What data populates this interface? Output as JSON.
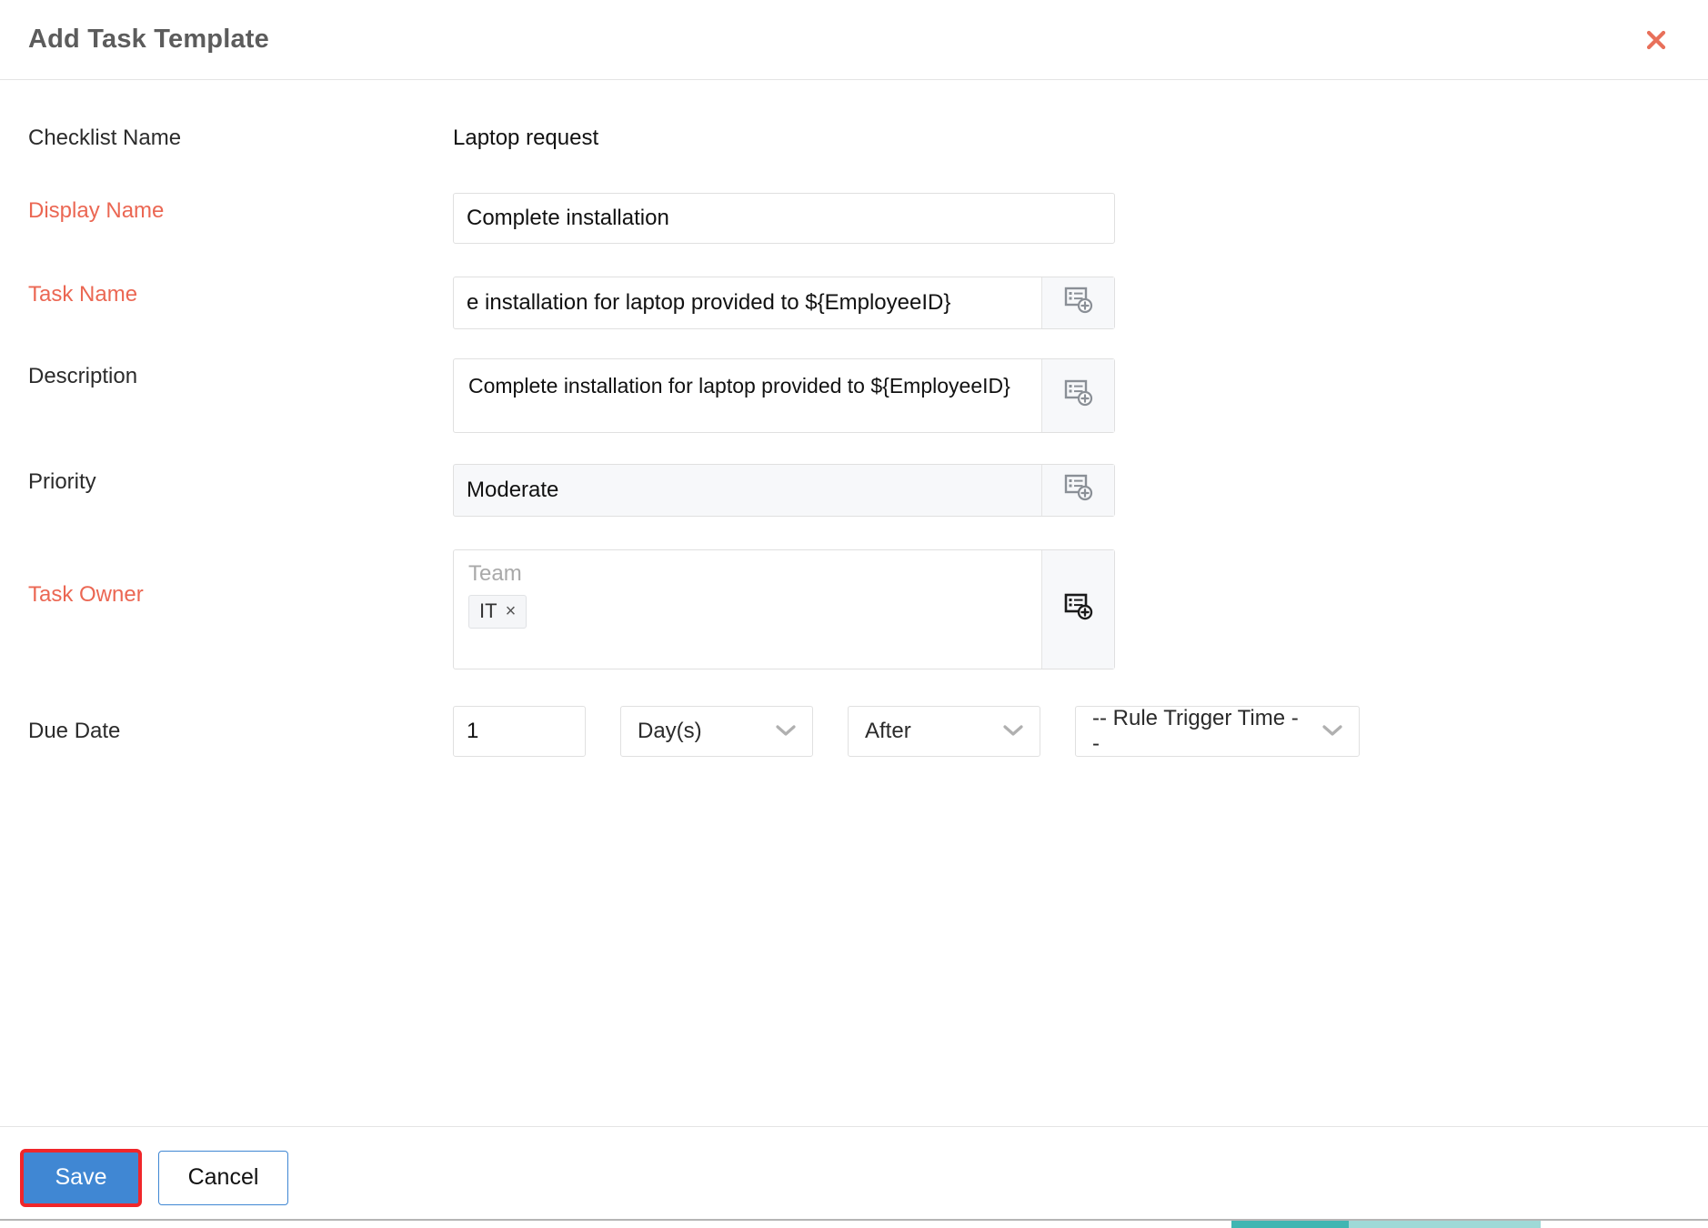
{
  "dialog": {
    "title": "Add Task Template",
    "close_icon": "close-icon"
  },
  "fields": {
    "checklist_name": {
      "label": "Checklist Name",
      "value": "Laptop request"
    },
    "display_name": {
      "label": "Display Name",
      "value": "Complete installation",
      "placeholder": ""
    },
    "task_name": {
      "label": "Task Name",
      "value": "e installation for laptop provided to ${EmployeeID}",
      "placeholder": "",
      "insert_icon": "insert-field-icon"
    },
    "description": {
      "label": "Description",
      "value": "Complete installation for laptop provided to ${EmployeeID}",
      "placeholder": "",
      "insert_icon": "insert-field-icon"
    },
    "priority": {
      "label": "Priority",
      "value": "Moderate",
      "insert_icon": "insert-field-icon"
    },
    "task_owner": {
      "label": "Task Owner",
      "placeholder": "Team",
      "chips": [
        {
          "label": "IT",
          "remove": "×"
        }
      ],
      "insert_icon": "insert-field-icon"
    },
    "due_date": {
      "label": "Due Date",
      "amount": "1",
      "amount_placeholder": "",
      "unit": "Day(s)",
      "offset": "After",
      "anchor": "-- Rule Trigger Time --",
      "chevron_icon": "chevron-down-icon"
    }
  },
  "footer": {
    "save_label": "Save",
    "cancel_label": "Cancel"
  },
  "colors": {
    "required_label": "#eb6753",
    "close_icon": "#e8705a",
    "primary_button": "#4087d3",
    "highlight_outline": "#f0262a",
    "title": "#5c5c5c",
    "sliver": "#3fb6b2"
  }
}
